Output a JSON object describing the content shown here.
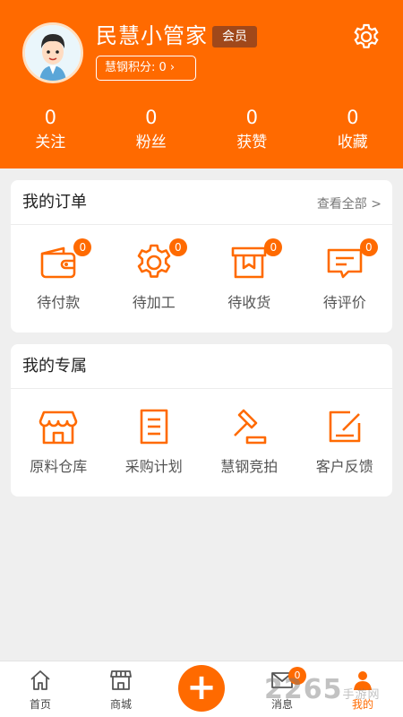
{
  "profile": {
    "name": "民慧小管家",
    "member_badge": "会员",
    "points_label": "慧钢积分: 0 ›",
    "avatar_icon": "cartoon-avatar-icon",
    "settings_icon": "gear-icon"
  },
  "stats": [
    {
      "value": "0",
      "label": "关注"
    },
    {
      "value": "0",
      "label": "粉丝"
    },
    {
      "value": "0",
      "label": "获赞"
    },
    {
      "value": "0",
      "label": "收藏"
    }
  ],
  "orders": {
    "title": "我的订单",
    "view_all": "查看全部 >",
    "items": [
      {
        "label": "待付款",
        "badge": "0",
        "icon": "wallet-icon"
      },
      {
        "label": "待加工",
        "badge": "0",
        "icon": "gear-icon"
      },
      {
        "label": "待收货",
        "badge": "0",
        "icon": "package-icon"
      },
      {
        "label": "待评价",
        "badge": "0",
        "icon": "comment-icon"
      }
    ]
  },
  "exclusive": {
    "title": "我的专属",
    "items": [
      {
        "label": "原料仓库",
        "icon": "warehouse-icon"
      },
      {
        "label": "采购计划",
        "icon": "clipboard-icon"
      },
      {
        "label": "慧钢竞拍",
        "icon": "gavel-icon"
      },
      {
        "label": "客户反馈",
        "icon": "edit-icon"
      }
    ]
  },
  "tabbar": {
    "items": [
      {
        "label": "首页",
        "icon": "home-icon"
      },
      {
        "label": "商城",
        "icon": "store-icon"
      },
      {
        "label": "+",
        "icon": "plus-icon"
      },
      {
        "label": "消息",
        "icon": "mail-icon",
        "badge": "0"
      },
      {
        "label": "我的",
        "icon": "user-icon"
      }
    ]
  },
  "watermark": {
    "main": "2265",
    "sub": "手游网"
  },
  "colors": {
    "accent": "#ff6a00",
    "badge_dark": "#a0481a",
    "background": "#efefef"
  }
}
